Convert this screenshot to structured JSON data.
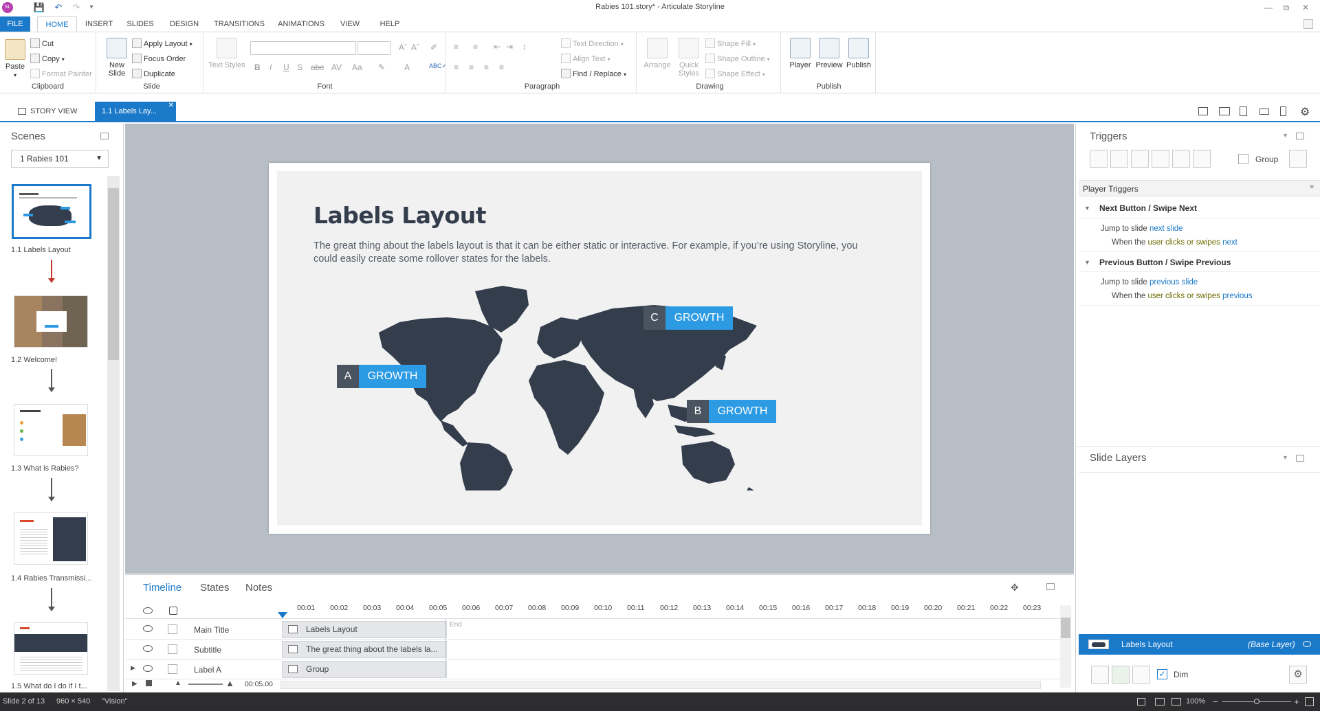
{
  "window": {
    "title": "Rabies 101.story* - Articulate Storyline",
    "app_badge": "SL"
  },
  "menu_tabs": [
    {
      "label": "FILE"
    },
    {
      "label": "HOME"
    },
    {
      "label": "INSERT"
    },
    {
      "label": "SLIDES"
    },
    {
      "label": "DESIGN"
    },
    {
      "label": "TRANSITIONS"
    },
    {
      "label": "ANIMATIONS"
    },
    {
      "label": "VIEW"
    },
    {
      "label": "HELP"
    }
  ],
  "ribbon": {
    "clipboard": {
      "paste": "Paste",
      "cut": "Cut",
      "copy": "Copy",
      "format_painter": "Format Painter",
      "label": "Clipboard"
    },
    "slide": {
      "new_slide": "New Slide",
      "apply_layout": "Apply Layout",
      "focus_order": "Focus Order",
      "duplicate": "Duplicate",
      "label": "Slide"
    },
    "font": {
      "text_styles": "Text Styles",
      "label": "Font"
    },
    "paragraph": {
      "text_direction": "Text Direction",
      "align_text": "Align Text",
      "find_replace": "Find / Replace",
      "label": "Paragraph"
    },
    "drawing": {
      "arrange": "Arrange",
      "quick_styles": "Quick Styles",
      "shape_fill": "Shape Fill",
      "shape_outline": "Shape Outline",
      "shape_effect": "Shape Effect",
      "label": "Drawing"
    },
    "publish": {
      "player": "Player",
      "preview": "Preview",
      "publish": "Publish",
      "label": "Publish"
    }
  },
  "doc_tabs": {
    "story_view": "STORY VIEW",
    "active": "1.1 Labels Lay..."
  },
  "scenes": {
    "title": "Scenes",
    "selected_scene": "1 Rabies 101",
    "slides": [
      {
        "label": "1.1 Labels Layout"
      },
      {
        "label": "1.2 Welcome!"
      },
      {
        "label": "1.3 What is Rabies?"
      },
      {
        "label": "1.4 Rabies Transmissi..."
      },
      {
        "label": "1.5 What do I do if I t..."
      }
    ]
  },
  "slide": {
    "title": "Labels Layout",
    "subtitle": "The great thing about the labels layout is that it can be either static or interactive. For example, if you’re using Storyline, you could easily create some rollover states for the labels.",
    "labels": [
      {
        "letter": "A",
        "text": "GROWTH"
      },
      {
        "letter": "B",
        "text": "GROWTH"
      },
      {
        "letter": "C",
        "text": "GROWTH"
      }
    ]
  },
  "timeline": {
    "tabs": [
      "Timeline",
      "States",
      "Notes"
    ],
    "ticks": [
      "00:01",
      "00:02",
      "00:03",
      "00:04",
      "00:05",
      "00:06",
      "00:07",
      "00:08",
      "00:09",
      "00:10",
      "00:11",
      "00:12",
      "00:13",
      "00:14",
      "00:15",
      "00:16",
      "00:17",
      "00:18",
      "00:19",
      "00:20",
      "00:21",
      "00:22",
      "00:23"
    ],
    "end_label": "End",
    "rows": [
      {
        "name": "Main Title",
        "bar": "Labels Layout"
      },
      {
        "name": "Subtitle",
        "bar": "The great thing about the labels la..."
      },
      {
        "name": "Label A",
        "bar": "Group"
      }
    ],
    "duration": "00:05.00"
  },
  "triggers": {
    "title": "Triggers",
    "group_label": "Group",
    "player_triggers": "Player Triggers",
    "sections": [
      {
        "name": "Next Button / Swipe Next",
        "action": "Jump to slide",
        "action_target": "next slide",
        "cond_prefix": "When the",
        "cond_user": "user clicks or swipes",
        "cond_target": "next"
      },
      {
        "name": "Previous Button / Swipe Previous",
        "action": "Jump to slide",
        "action_target": "previous slide",
        "cond_prefix": "When the",
        "cond_user": "user clicks or swipes",
        "cond_target": "previous"
      }
    ]
  },
  "layers": {
    "title": "Slide Layers",
    "base_name": "Labels Layout",
    "base_tag": "(Base Layer)",
    "dim_label": "Dim"
  },
  "status": {
    "slide_info": "Slide 2 of 13",
    "dimensions": "960 × 540",
    "theme": "\"Vision\"",
    "zoom": "100%"
  },
  "colors": {
    "accent": "#1b79c9",
    "label_blue": "#2c9be4",
    "label_dark": "#4a5360",
    "map": "#333d4c"
  }
}
